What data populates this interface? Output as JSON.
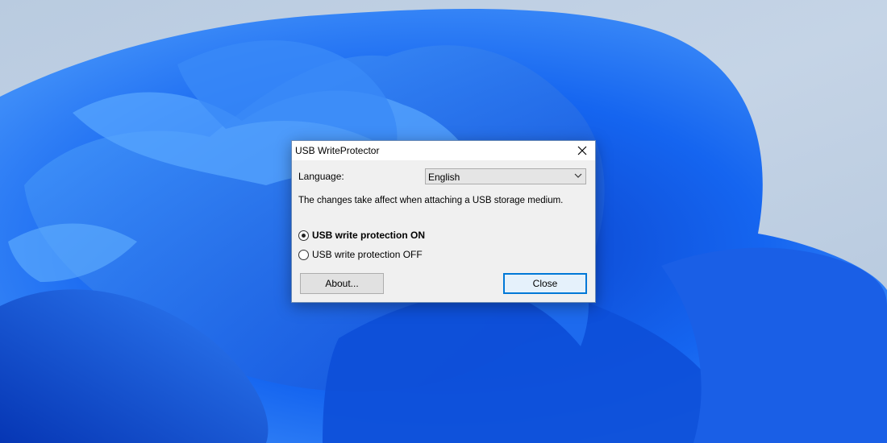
{
  "dialog": {
    "title": "USB WriteProtector",
    "close_icon": "close-icon",
    "language_label": "Language:",
    "language_value": "English",
    "info_text": "The changes take affect when attaching a USB storage medium.",
    "protection_on_label": "USB write protection ON",
    "protection_off_label": "USB write protection OFF",
    "selected_option": "on",
    "about_button": "About...",
    "close_button": "Close"
  },
  "colors": {
    "accent": "#0078d7",
    "dialog_bg": "#f0f0f0",
    "wallpaper_blue": "#1a6bf0"
  }
}
